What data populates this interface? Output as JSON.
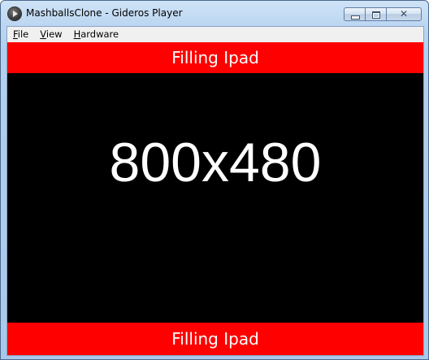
{
  "window": {
    "title": "MashballsClone - Gideros Player",
    "app_icon": "gideros-player-icon",
    "controls": {
      "minimize_icon": "minimize-icon",
      "maximize_icon": "maximize-icon",
      "close_icon": "close-icon",
      "close_glyph": "✕"
    }
  },
  "menubar": {
    "items": [
      {
        "label_accel": "F",
        "label_rest": "ile"
      },
      {
        "label_accel": "V",
        "label_rest": "iew"
      },
      {
        "label_accel": "H",
        "label_rest": "ardware"
      }
    ]
  },
  "stage": {
    "top_band_text": "Filling Ipad",
    "bottom_band_text": "Filling Ipad",
    "resolution_text": "800x480",
    "colors": {
      "band": "#ff0000",
      "background": "#000000",
      "text": "#ffffff"
    }
  }
}
